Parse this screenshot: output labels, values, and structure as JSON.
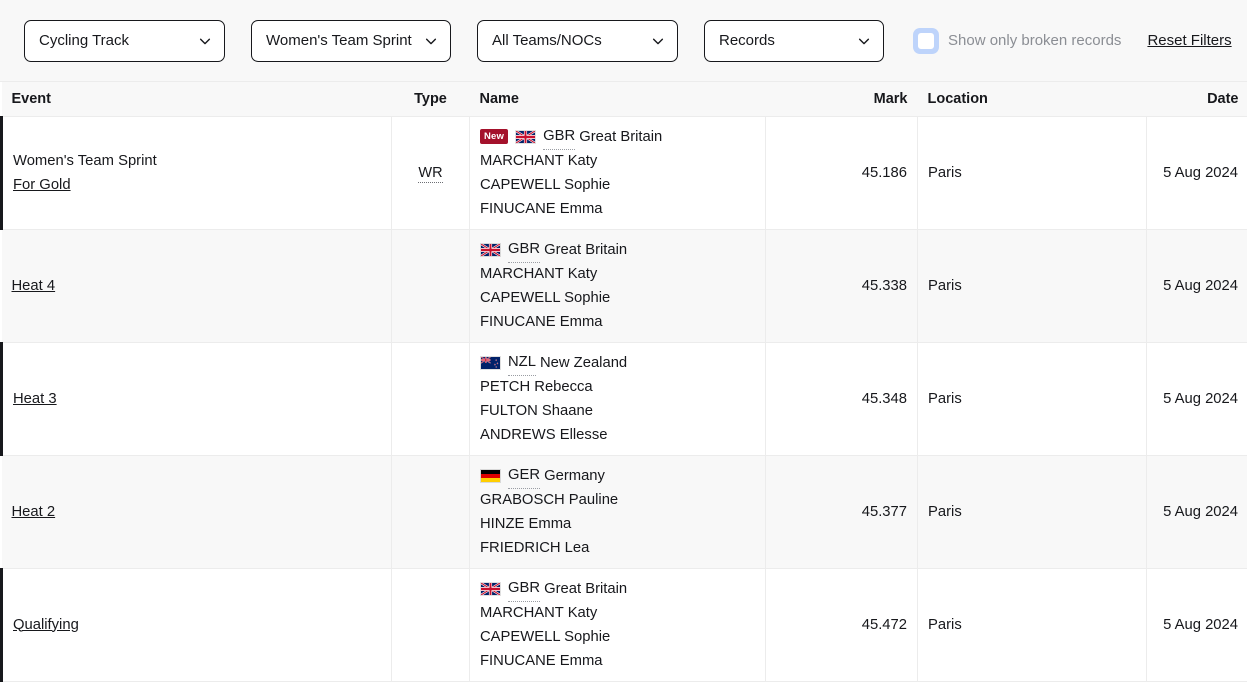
{
  "filters": {
    "sport": {
      "value": "Cycling Track",
      "icon": "chevron-down-icon"
    },
    "event": {
      "value": "Women's Team Sprint",
      "icon": "chevron-down-icon"
    },
    "team": {
      "value": "All Teams/NOCs",
      "icon": "chevron-down-icon"
    },
    "record_type": {
      "value": "Records",
      "icon": "chevron-down-icon"
    },
    "broken_only": {
      "label": "Show only broken records",
      "checked": false
    },
    "reset": {
      "label": "Reset Filters"
    }
  },
  "table": {
    "columns": [
      "Event",
      "Type",
      "Name",
      "Mark",
      "Location",
      "Date"
    ],
    "rows": [
      {
        "event_title": "Women's Team Sprint",
        "event_link": "For Gold",
        "type": "WR",
        "new_badge": "New",
        "flag": "gbr-flag",
        "noc": "GBR",
        "team": "Great Britain",
        "athletes": [
          "MARCHANT Katy",
          "CAPEWELL Sophie",
          "FINUCANE Emma"
        ],
        "mark": "45.186",
        "location": "Paris",
        "date": "5 Aug 2024"
      },
      {
        "event_title": "",
        "event_link": "Heat 4",
        "type": "",
        "new_badge": "",
        "flag": "gbr-flag",
        "noc": "GBR",
        "team": "Great Britain",
        "athletes": [
          "MARCHANT Katy",
          "CAPEWELL Sophie",
          "FINUCANE Emma"
        ],
        "mark": "45.338",
        "location": "Paris",
        "date": "5 Aug 2024"
      },
      {
        "event_title": "",
        "event_link": "Heat 3",
        "type": "",
        "new_badge": "",
        "flag": "nzl-flag",
        "noc": "NZL",
        "team": "New Zealand",
        "athletes": [
          "PETCH Rebecca",
          "FULTON Shaane",
          "ANDREWS Ellesse"
        ],
        "mark": "45.348",
        "location": "Paris",
        "date": "5 Aug 2024"
      },
      {
        "event_title": "",
        "event_link": "Heat 2",
        "type": "",
        "new_badge": "",
        "flag": "ger-flag",
        "noc": "GER",
        "team": "Germany",
        "athletes": [
          "GRABOSCH Pauline",
          "HINZE Emma",
          "FRIEDRICH Lea"
        ],
        "mark": "45.377",
        "location": "Paris",
        "date": "5 Aug 2024"
      },
      {
        "event_title": "",
        "event_link": "Qualifying",
        "type": "",
        "new_badge": "",
        "flag": "gbr-flag",
        "noc": "GBR",
        "team": "Great Britain",
        "athletes": [
          "MARCHANT Katy",
          "CAPEWELL Sophie",
          "FINUCANE Emma"
        ],
        "mark": "45.472",
        "location": "Paris",
        "date": "5 Aug 2024"
      }
    ]
  },
  "colors": {
    "badge_red": "#a4112b",
    "row_alt": "#f8f8f8",
    "border": "#ececec",
    "checkbox_ring": "#bed4fb",
    "text": "#17181c"
  }
}
